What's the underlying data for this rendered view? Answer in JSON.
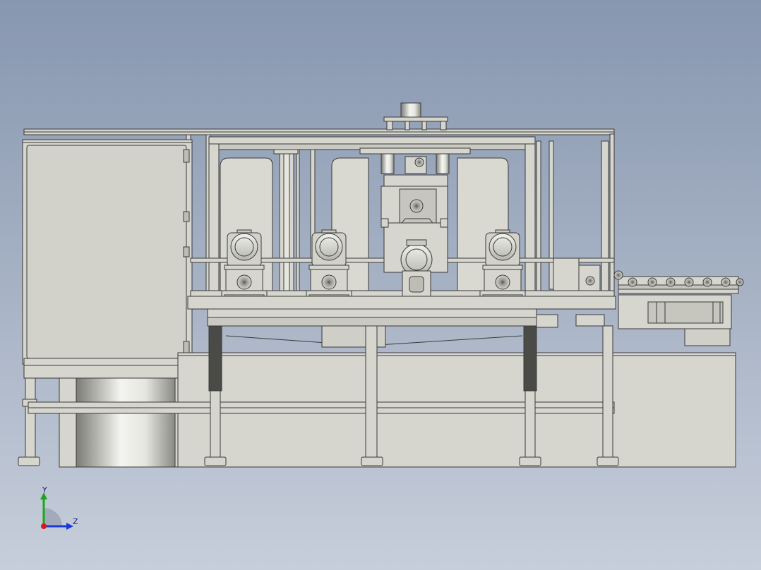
{
  "viewport": {
    "background_top": "#8797b0",
    "background_bottom": "#c7cedb"
  },
  "model": {
    "part_fill": "#d6d6cf",
    "part_fill_dark": "#b9b9b1",
    "edge_color": "#3a3a3a",
    "cylinder_highlight": "#ffffff"
  },
  "triad": {
    "y_label": "Y",
    "z_label": "Z",
    "y_color": "#1aa81a",
    "z_color": "#1a3ad8",
    "x_color": "#d81a1a"
  }
}
